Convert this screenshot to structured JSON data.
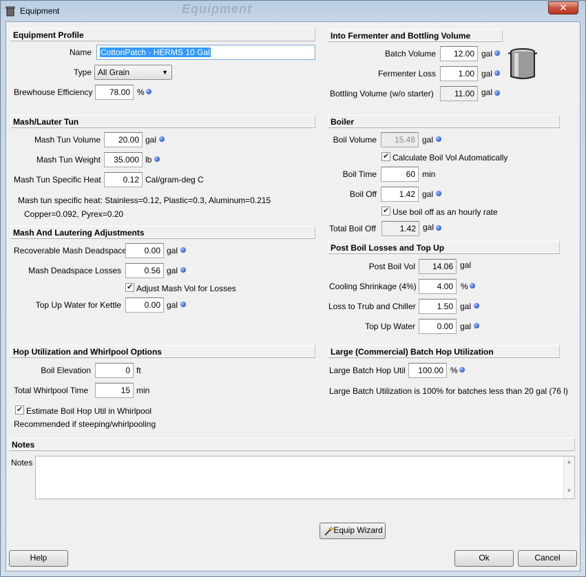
{
  "window": {
    "title": "Equipment",
    "ghost_title": "Equipment",
    "close_symbol": "✕"
  },
  "equipment_profile": {
    "header": "Equipment Profile",
    "name_label": "Name",
    "name_value": "CottonPatch - HERMS 10 Gal",
    "type_label": "Type",
    "type_value": "All Grain",
    "efficiency_label": "Brewhouse Efficiency",
    "efficiency_value": "78.00",
    "efficiency_unit": "%"
  },
  "fermenter": {
    "header": "Into Fermenter and Bottling Volume",
    "batch_label": "Batch Volume",
    "batch_value": "12.00",
    "batch_unit": "gal",
    "loss_label": "Fermenter Loss",
    "loss_value": "1.00",
    "loss_unit": "gal",
    "bottling_label": "Bottling Volume (w/o starter)",
    "bottling_value": "11.00",
    "bottling_unit": "gal"
  },
  "mash_tun": {
    "header": "Mash/Lauter Tun",
    "volume_label": "Mash Tun Volume",
    "volume_value": "20.00",
    "volume_unit": "gal",
    "weight_label": "Mash Tun Weight",
    "weight_value": "35.000",
    "weight_unit": "lb",
    "heat_label": "Mash Tun Specific Heat",
    "heat_value": "0.12",
    "heat_unit": "Cal/gram-deg C",
    "note_line1": "Mash tun specific heat: Stainless=0.12, Plastic=0.3, Aluminum=0.215",
    "note_line2": "Copper=0.092, Pyrex=0.20"
  },
  "boiler": {
    "header": "Boiler",
    "volume_label": "Boil Volume",
    "volume_value": "15.48",
    "volume_unit": "gal",
    "calc_auto_label": "Calculate Boil Vol Automatically",
    "time_label": "Boil Time",
    "time_value": "60",
    "time_unit": "min",
    "off_label": "Boil Off",
    "off_value": "1.42",
    "off_unit": "gal",
    "hourly_label": "Use boil off as an hourly rate",
    "total_label": "Total Boil Off",
    "total_value": "1.42",
    "total_unit": "gal"
  },
  "lautering": {
    "header": "Mash And Lautering Adjustments",
    "deadspace_label": "Recoverable Mash Deadspace",
    "deadspace_value": "0.00",
    "deadspace_unit": "gal",
    "losses_label": "Mash Deadspace Losses",
    "losses_value": "0.56",
    "losses_unit": "gal",
    "adjust_label": "Adjust Mash Vol for Losses",
    "topup_label": "Top Up Water for Kettle",
    "topup_value": "0.00",
    "topup_unit": "gal"
  },
  "post_boil": {
    "header": "Post Boil Losses and Top Up",
    "vol_label": "Post Boil Vol",
    "vol_value": "14.06",
    "vol_unit": "gal",
    "shrink_label": "Cooling Shrinkage (4%)",
    "shrink_value": "4.00",
    "shrink_unit": "%",
    "trub_label": "Loss to Trub and Chiller",
    "trub_value": "1.50",
    "trub_unit": "gal",
    "topup_label": "Top Up Water",
    "topup_value": "0.00",
    "topup_unit": "gal"
  },
  "hop_util": {
    "header": "Hop Utilization and Whirlpool Options",
    "elev_label": "Boil Elevation",
    "elev_value": "0",
    "elev_unit": "ft",
    "whirl_label": "Total Whirlpool Time",
    "whirl_value": "15",
    "whirl_unit": "min",
    "estimate_label": "Estimate Boil Hop Util in Whirlpool",
    "recommend": "Recommended if steeping/whirlpooling"
  },
  "large_batch": {
    "header": "Large (Commercial) Batch Hop Utilization",
    "util_label": "Large Batch Hop Util",
    "util_value": "100.00",
    "util_unit": "%",
    "note": "Large Batch Utilization is 100% for batches less than 20 gal (76 l)"
  },
  "notes": {
    "header": "Notes",
    "label": "Notes",
    "value": ""
  },
  "buttons": {
    "wizard": "Equip Wizard",
    "help": "Help",
    "ok": "Ok",
    "cancel": "Cancel"
  },
  "colors": {
    "info_dot": "#3c68d6",
    "selection": "#3399ff",
    "close": "#c7533d"
  }
}
